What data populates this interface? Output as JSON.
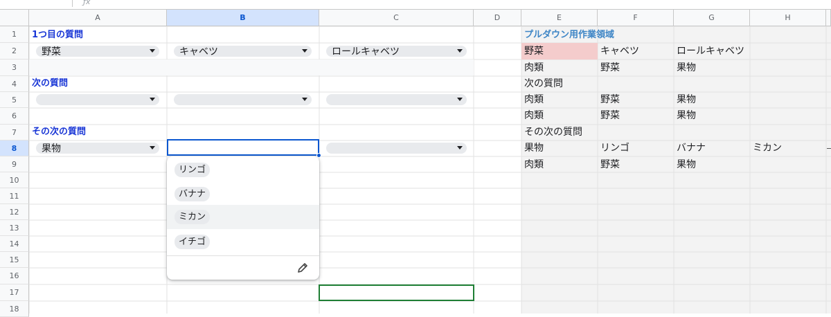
{
  "columns": [
    "A",
    "B",
    "C",
    "D",
    "E",
    "F",
    "G",
    "H"
  ],
  "rows": [
    "1",
    "2",
    "3",
    "4",
    "5",
    "6",
    "7",
    "8",
    "9",
    "10",
    "11",
    "12",
    "13",
    "14",
    "15",
    "16",
    "17",
    "18"
  ],
  "headings": {
    "q1": "1つ目の質問",
    "q2": "次の質問",
    "q3": "その次の質問",
    "work_area": "プルダウン用作業領域"
  },
  "dropdowns": {
    "a2": "野菜",
    "b2": "キャベツ",
    "c2": "ロールキャベツ",
    "a5": "",
    "b5": "",
    "c5": "",
    "a8": "果物",
    "c8": ""
  },
  "work": {
    "e2": "野菜",
    "f2": "キャベツ",
    "g2": "ロールキャベツ",
    "e3": "肉類",
    "f3": "野菜",
    "g3": "果物",
    "e4": "次の質問",
    "e5": "肉類",
    "f5": "野菜",
    "g5": "果物",
    "e6": "肉類",
    "f6": "野菜",
    "g6": "果物",
    "e7": "その次の質問",
    "e8": "果物",
    "f8": "リンゴ",
    "g8": "バナナ",
    "h8": "ミカン",
    "e9": "肉類",
    "f9": "野菜",
    "g9": "果物"
  },
  "menu_options": [
    "リンゴ",
    "バナナ",
    "ミカン",
    "イチゴ"
  ],
  "colors": {
    "accent": "#0b57d0",
    "heading": "#1a37d6",
    "work_heading": "#3d85c6",
    "pink_fill": "#f4cccc",
    "work_fill": "#f3f3f3",
    "highlight_border": "#1e7e34"
  },
  "icons": {
    "edit": "pencil-icon",
    "dropdown": "triangle-down-icon"
  }
}
